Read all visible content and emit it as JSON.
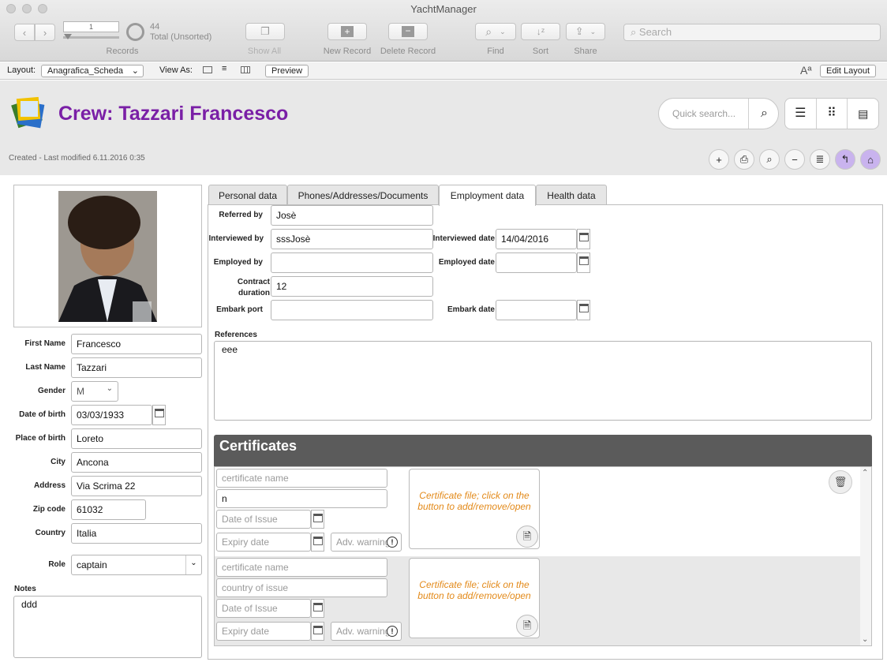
{
  "window": {
    "title": "YachtManager"
  },
  "toolbar": {
    "record_number": "1",
    "total_count": "44",
    "total_status": "Total (Unsorted)",
    "records_label": "Records",
    "show_all": "Show All",
    "new_record": "New Record",
    "delete_record": "Delete Record",
    "find": "Find",
    "sort": "Sort",
    "share": "Share",
    "search_placeholder": "Search"
  },
  "layoutbar": {
    "layout_label": "Layout:",
    "layout_value": "Anagrafica_Scheda",
    "view_as": "View As:",
    "preview": "Preview",
    "font_icon": "Aª",
    "edit_layout": "Edit Layout"
  },
  "header": {
    "title": "Crew: Tazzari Francesco",
    "meta": "Created  - Last modified 6.11.2016 0:35",
    "quick_search_placeholder": "Quick search..."
  },
  "person": {
    "first_name_label": "First Name",
    "first_name": "Francesco",
    "last_name_label": "Last Name",
    "last_name": "Tazzari",
    "gender_label": "Gender",
    "gender": "M",
    "dob_label": "Date of birth",
    "dob": "03/03/1933",
    "pob_label": "Place of birth",
    "pob": "Loreto",
    "city_label": "City",
    "city": "Ancona",
    "address_label": "Address",
    "address": "Via Scrima 22",
    "zip_label": "Zip code",
    "zip": "61032",
    "country_label": "Country",
    "country": "Italia",
    "role_label": "Role",
    "role": "captain",
    "notes_label": "Notes",
    "notes": "ddd"
  },
  "tabs": [
    "Personal data",
    "Phones/Addresses/Documents",
    "Employment data",
    "Health data"
  ],
  "employment": {
    "referred_by_label": "Referred by",
    "referred_by": "Josè",
    "interviewed_by_label": "Interviewed by",
    "interviewed_by": "sssJosè",
    "interviewed_date_label": "Interviewed  date",
    "interviewed_date": "14/04/2016",
    "employed_by_label": "Employed by",
    "employed_by": "",
    "employed_date_label": "Employed  date",
    "employed_date": "",
    "contract_label_1": "Contract",
    "contract_label_2": "duration",
    "contract_duration": "12",
    "embark_port_label": "Embark port",
    "embark_port": "",
    "embark_date_label": "Embark  date",
    "embark_date": "",
    "references_label": "References",
    "references": "eee"
  },
  "certificates": {
    "title": "Certificates",
    "rows": [
      {
        "name_placeholder": "certificate name",
        "name": "",
        "country_placeholder": "country of issue",
        "country": "n",
        "issue_placeholder": "Date of Issue",
        "expiry_placeholder": "Expiry date",
        "warning_placeholder": "Adv. warning",
        "file_text": "Certificate file; click on the button to add/remove/open"
      },
      {
        "name_placeholder": "certificate name",
        "name": "",
        "country_placeholder": "country of issue",
        "country": "",
        "issue_placeholder": "Date of Issue",
        "expiry_placeholder": "Expiry date",
        "warning_placeholder": "Adv. warning",
        "file_text": "Certificate file; click on the button to add/remove/open"
      }
    ]
  },
  "colors": {
    "title": "#7a1fa6",
    "accent": "#c9b3ee",
    "cert_header": "#5b5b5b",
    "file_text": "#e38a1a"
  }
}
